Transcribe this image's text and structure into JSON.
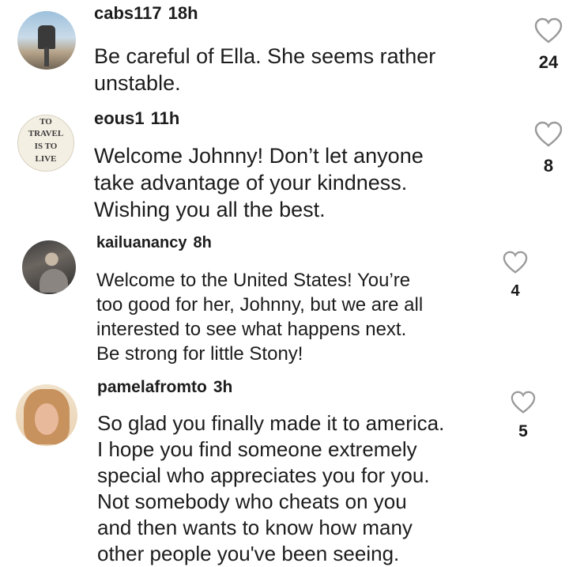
{
  "comments": [
    {
      "username": "cabs117",
      "time": "18h",
      "lines": [
        "Be careful of Ella. She seems rather",
        "unstable."
      ],
      "likes": "24",
      "avatar": "binocular-viewer-photo"
    },
    {
      "username": "eous1",
      "time": "11h",
      "lines": [
        "Welcome Johnny!  Don’t let anyone",
        "take advantage of your kindness.",
        "Wishing you all the best."
      ],
      "likes": "8",
      "avatar": "to-travel-is-to-live-badge",
      "avatar_text": [
        "TO",
        "TRAVEL",
        "IS TO",
        "LIVE"
      ]
    },
    {
      "username": "kailuanancy",
      "time": "8h",
      "lines": [
        "Welcome to the United States! You’re",
        "too good for her, Johnny, but we are all",
        "interested to see what happens next.",
        "Be strong for little Stony!"
      ],
      "likes": "4",
      "avatar": "user-photo"
    },
    {
      "username": "pamelafromto",
      "time": "3h",
      "lines": [
        "So glad you finally made it to america.",
        "I hope you find someone extremely",
        "special who appreciates you for you.",
        "Not somebody who cheats on you",
        "and then wants to know how many",
        "other people you've been seeing."
      ],
      "likes": "5",
      "avatar": "user-photo"
    }
  ],
  "colors": {
    "text": "#1a1a1a",
    "heart_stroke": "#9a9a9a",
    "background": "#ffffff"
  }
}
